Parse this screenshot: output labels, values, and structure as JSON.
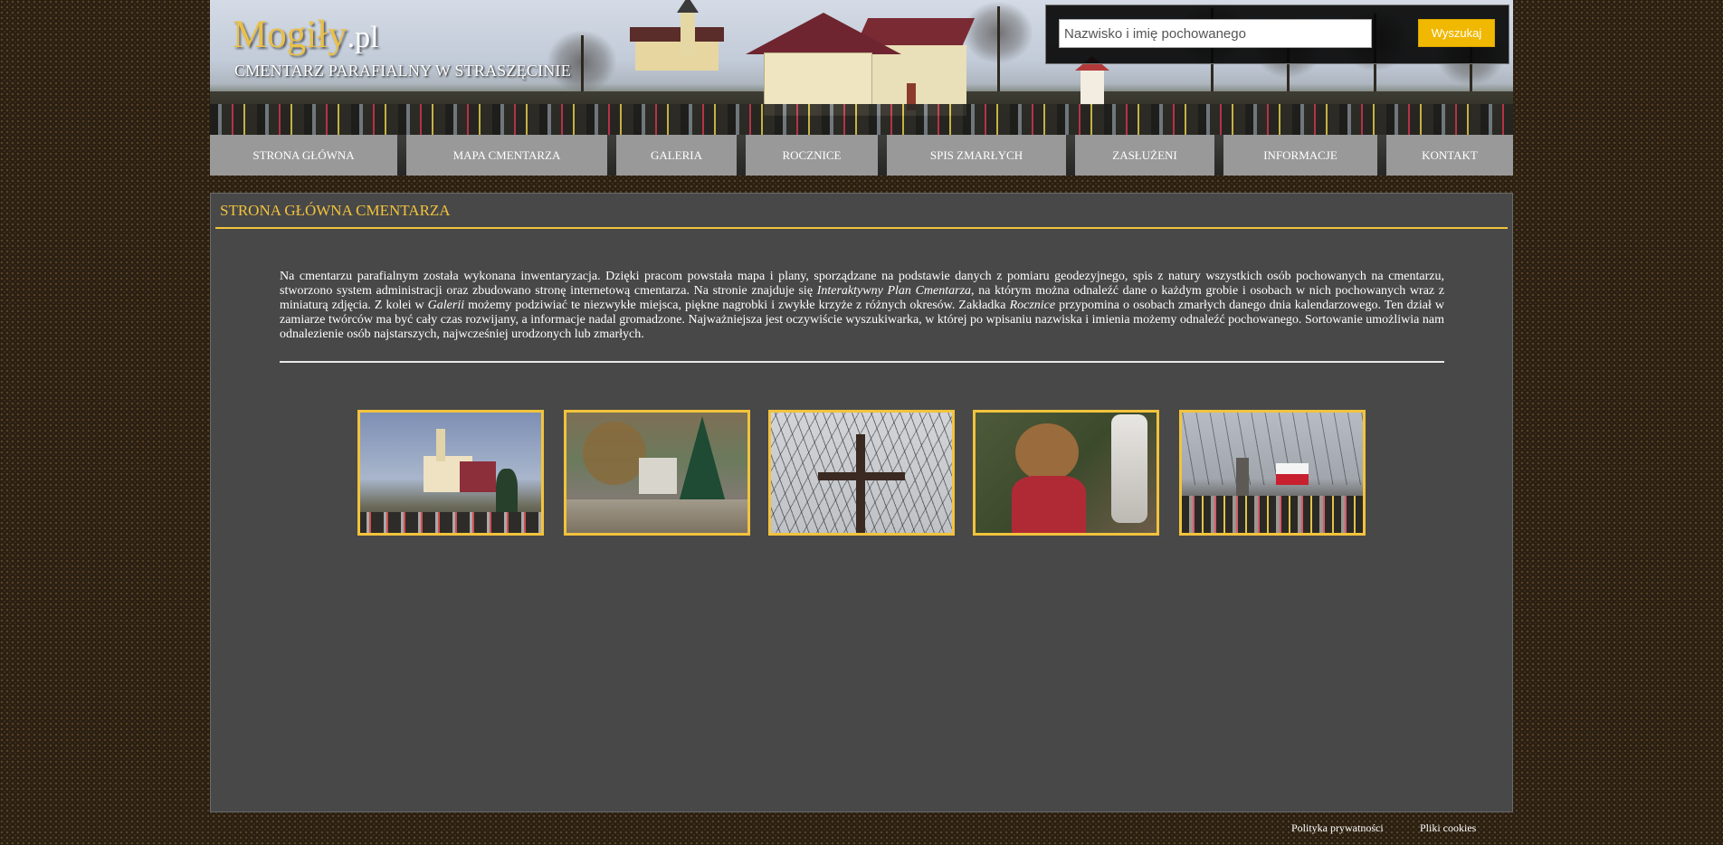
{
  "header": {
    "logo_main": "Mogiły",
    "logo_domain": ".pl",
    "subtitle": "CMENTARZ PARAFIALNY W STRASZĘCINIE",
    "accent_color": "#e9c04a"
  },
  "search": {
    "placeholder": "Nazwisko i imię pochowanego",
    "value": "",
    "button_label": "Wyszukaj",
    "button_color": "#f0b800"
  },
  "nav": {
    "items": [
      {
        "label": "STRONA GŁÓWNA"
      },
      {
        "label": "MAPA CMENTARZA"
      },
      {
        "label": "GALERIA"
      },
      {
        "label": "ROCZNICE"
      },
      {
        "label": "SPIS ZMARŁYCH"
      },
      {
        "label": "ZASŁUŻENI"
      },
      {
        "label": "INFORMACJE"
      },
      {
        "label": "KONTAKT"
      }
    ],
    "background_color": "#999999"
  },
  "main": {
    "title": "STRONA GŁÓWNA CMENTARZA",
    "title_color": "#f2c33c",
    "intro": {
      "text_1": "Na cmentarzu parafialnym została wykonana inwentaryzacja. Dzięki pracom powstała mapa i plany, sporządzane na podstawie danych z pomiaru geodezyjnego, spis z natury wszystkich osób pochowanych na cmentarzu, stworzono system administracji oraz zbudowano stronę internetową cmentarza. Na stronie znajduje się ",
      "em_1": "Interaktywny Plan Cmentarza",
      "text_2": ", na którym można odnaleźć dane o każdym grobie i osobach w nich pochowanych wraz z miniaturą zdjęcia. Z kolei w ",
      "em_2": "Galerii",
      "text_3": " możemy podziwiać te niezwykłe miejsca, piękne nagrobki i zwykłe krzyże z różnych okresów. Zakładka ",
      "em_3": "Rocznice",
      "text_4": " przypomina o osobach zmarłych danego dnia kalendarzowego. Ten dział w zamiarze twórców ma być cały czas rozwijany, a informacje nadal gromadzone. Najważniejsza jest oczywiście wyszukiwarka, w której po wpisaniu nazwiska i imienia możemy odnaleźć pochowanego. Sortowanie umożliwia nam odnalezienie osób najstarszych, najwcześniej urodzonych lub zmarłych."
    },
    "gallery": [
      {
        "subject": "church-photo"
      },
      {
        "subject": "cemetery-alley-photo"
      },
      {
        "subject": "crucifix-photo"
      },
      {
        "subject": "teddy-bear-candle-photo"
      },
      {
        "subject": "graves-with-flag-photo"
      }
    ],
    "thumb_border_color": "#f2c33c"
  },
  "footer": {
    "privacy_label": "Polityka prywatności",
    "cookies_label": "Pliki cookies"
  }
}
